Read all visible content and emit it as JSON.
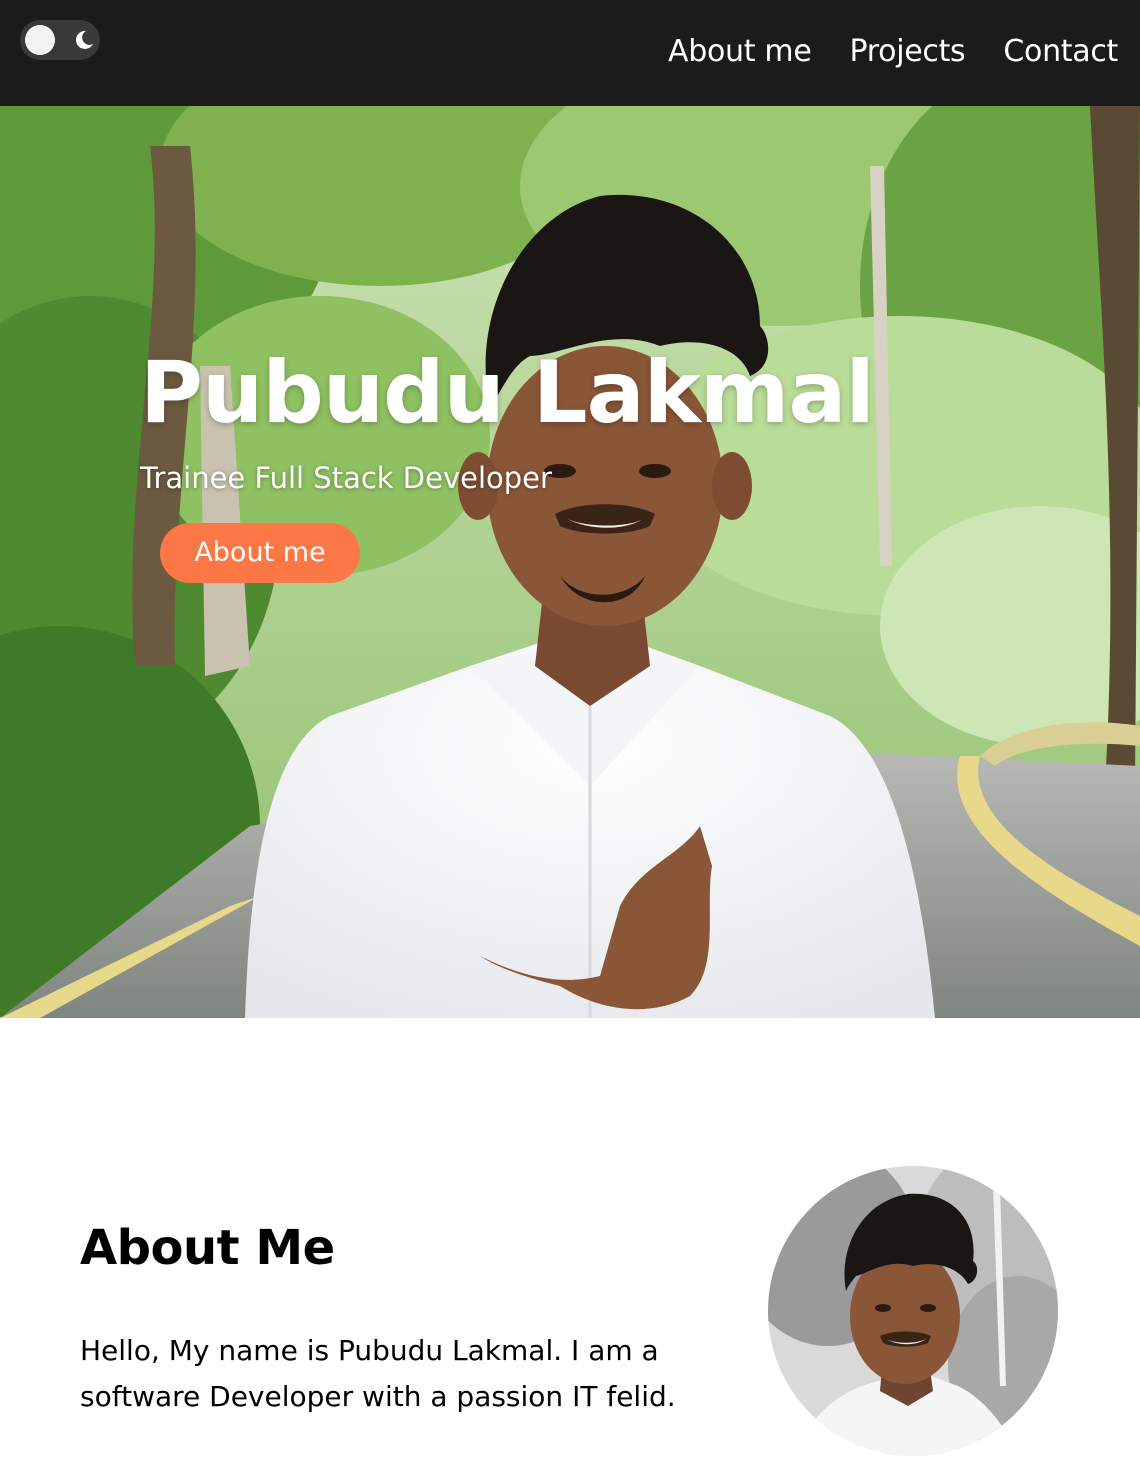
{
  "navbar": {
    "theme_toggle": {
      "icon": "moon-icon",
      "state": "light"
    },
    "links": [
      {
        "label": "About me"
      },
      {
        "label": "Projects"
      },
      {
        "label": "Contact"
      }
    ]
  },
  "hero": {
    "title": "Pubudu Lakmal",
    "subtitle": "Trainee Full Stack Developer",
    "button_label": "About me",
    "accent_color": "#fc7746"
  },
  "about": {
    "heading": "About Me",
    "text": "Hello, My name is Pubudu Lakmal. I am a software Developer with a passion IT felid."
  },
  "colors": {
    "navbar_bg": "#1b1b1b",
    "page_bg": "#ffffff",
    "accent": "#fc7746"
  }
}
